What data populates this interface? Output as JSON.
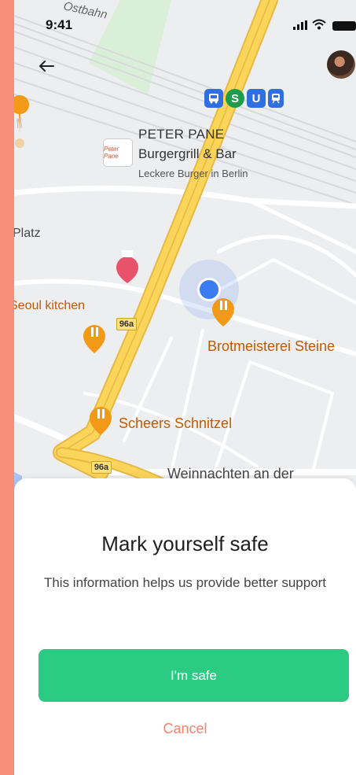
{
  "status_bar": {
    "time": "9:41"
  },
  "map": {
    "street_label": "Ostbahn",
    "transit_icons": [
      "bus",
      "S",
      "U",
      "train"
    ],
    "poi_featured": {
      "name": "PETER PANE",
      "category": "Burgergrill & Bar",
      "tagline": "Leckere Burger in Berlin",
      "logo_text": "Peter Pane"
    },
    "labels": {
      "platz": "Platz",
      "seoul": "Seoul kitchen",
      "brot": "Brotmeisterei Steine",
      "scheers": "Scheers Schnitzel",
      "weihnachten": "Weinnachten an der"
    },
    "road_badges": [
      "96a",
      "96a"
    ],
    "colors": {
      "road_major": "#FBD45A",
      "road_border": "#E7B944",
      "poi_food": "#F29A17",
      "poi_hotel": "#E8526A",
      "location_dot": "#3C7BF0"
    }
  },
  "sheet": {
    "title": "Mark yourself safe",
    "description": "This information helps us provide better support",
    "primary_button": "I'm safe",
    "secondary_button": "Cancel",
    "colors": {
      "primary": "#2CCB84",
      "cancel": "#F4826E"
    }
  }
}
